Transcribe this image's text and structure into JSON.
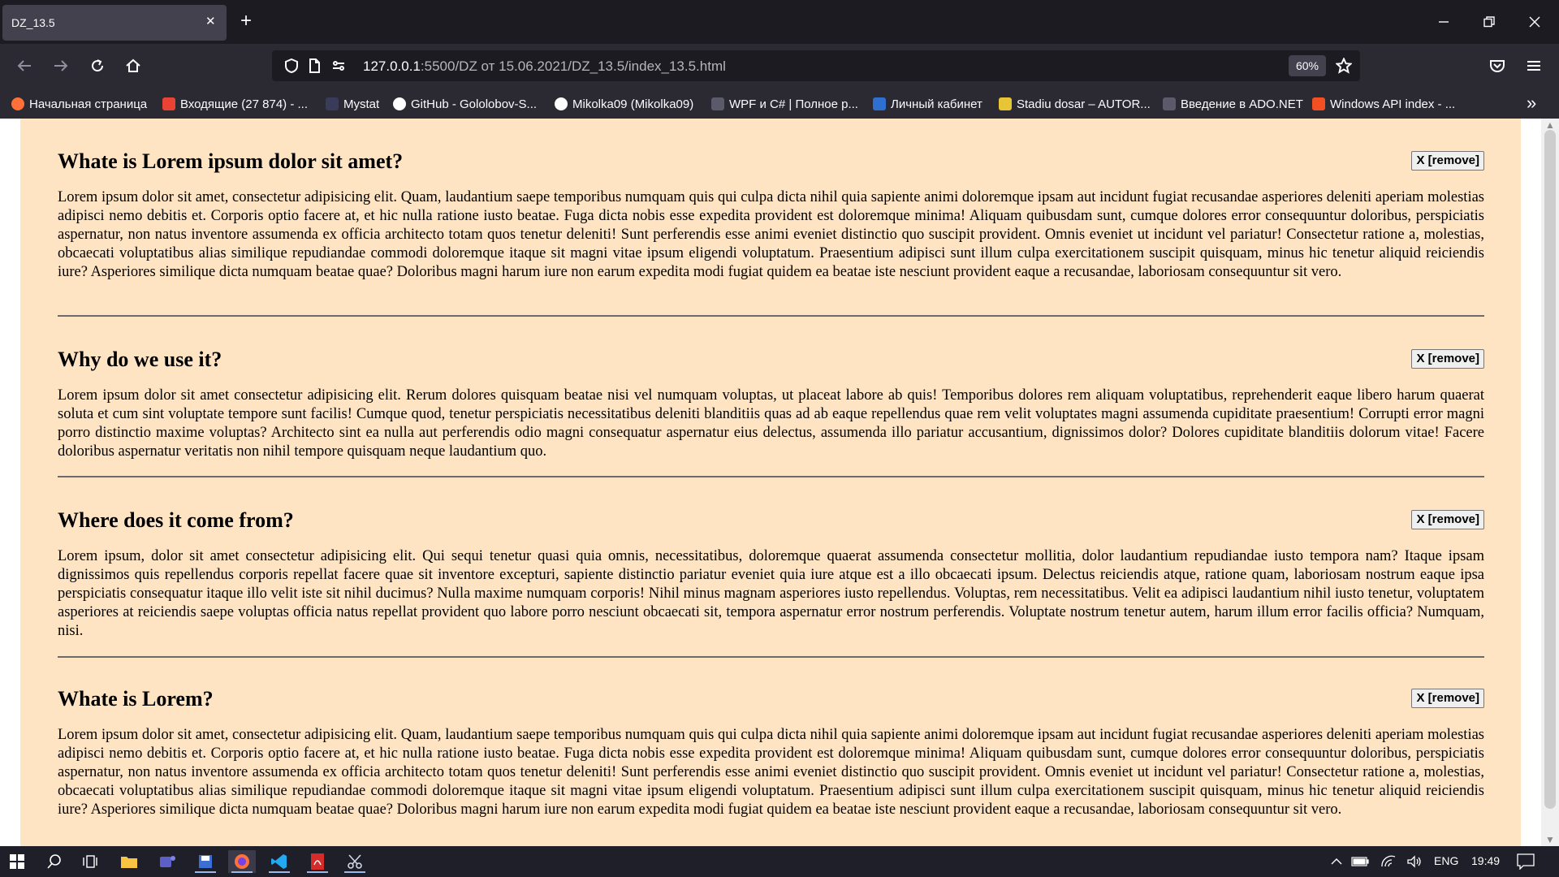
{
  "browser": {
    "tab_title": "DZ_13.5",
    "tab_close": "✕",
    "new_tab": "+",
    "url_host": "127.0.0.1",
    "url_rest": ":5500/DZ от 15.06.2021/DZ_13.5/index_13.5.html",
    "zoom": "60%"
  },
  "bookmarks": [
    {
      "label": "Начальная страница",
      "color": "#ff7139"
    },
    {
      "label": "Входящие (27 874) - ...",
      "color": "#ea4335"
    },
    {
      "label": "Mystat",
      "color": "#3a3a5a"
    },
    {
      "label": "GitHub - Gololobov-S...",
      "color": "#ffffff"
    },
    {
      "label": "Mikolka09 (Mikolka09)",
      "color": "#ffffff"
    },
    {
      "label": "WPF и C# | Полное р...",
      "color": "#5a5a6a"
    },
    {
      "label": "Личный кабинет",
      "color": "#2f6fd1"
    },
    {
      "label": "Stadiu dosar – AUTOR...",
      "color": "#e8c437"
    },
    {
      "label": "Введение в ADO.NET",
      "color": "#5a5a6a"
    },
    {
      "label": "Windows API index - ...",
      "color": "#f25022"
    }
  ],
  "articles": [
    {
      "title": "Whate is Lorem ipsum dolor sit amet?",
      "remove_label": "X [remove]",
      "text": "Lorem ipsum dolor sit amet, consectetur adipisicing elit. Quam, laudantium saepe temporibus numquam quis qui culpa dicta nihil quia sapiente animi doloremque ipsam aut incidunt fugiat recusandae asperiores deleniti aperiam molestias adipisci nemo debitis et. Corporis optio facere at, et hic nulla ratione iusto beatae. Fuga dicta nobis esse expedita provident est doloremque minima! Aliquam quibusdam sunt, cumque dolores error consequuntur doloribus, perspiciatis aspernatur, non natus inventore assumenda ex officia architecto totam quos tenetur deleniti! Sunt perferendis esse animi eveniet distinctio quo suscipit provident. Omnis eveniet ut incidunt vel pariatur! Consectetur ratione a, molestias, obcaecati voluptatibus alias similique repudiandae commodi doloremque itaque sit magni vitae ipsum eligendi voluptatum. Praesentium adipisci sunt illum culpa exercitationem suscipit quisquam, minus hic tenetur aliquid reiciendis iure? Asperiores similique dicta numquam beatae quae? Doloribus magni harum iure non earum expedita modi fugiat quidem ea beatae iste nesciunt provident eaque a recusandae, laboriosam consequuntur sit vero."
    },
    {
      "title": "Why do we use it?",
      "remove_label": "X [remove]",
      "text": "Lorem ipsum dolor sit amet consectetur adipisicing elit. Rerum dolores quisquam beatae nisi vel numquam voluptas, ut placeat labore ab quis! Temporibus dolores rem aliquam voluptatibus, reprehenderit eaque libero harum quaerat soluta et cum sint voluptate tempore sunt facilis! Cumque quod, tenetur perspiciatis necessitatibus deleniti blanditiis quas ad ab eaque repellendus quae rem velit voluptates magni assumenda cupiditate praesentium! Corrupti error magni porro distinctio maxime voluptas? Architecto sint ea nulla aut perferendis odio magni consequatur aspernatur eius delectus, assumenda illo pariatur accusantium, dignissimos dolor? Dolores cupiditate blanditiis dolorum vitae! Facere doloribus aspernatur veritatis non nihil tempore quisquam neque laudantium quo."
    },
    {
      "title": "Where does it come from?",
      "remove_label": "X [remove]",
      "text": "Lorem ipsum, dolor sit amet consectetur adipisicing elit. Qui sequi tenetur quasi quia omnis, necessitatibus, doloremque quaerat assumenda consectetur mollitia, dolor laudantium repudiandae iusto tempora nam? Itaque ipsam dignissimos quis repellendus corporis repellat facere quae sit inventore excepturi, sapiente distinctio pariatur eveniet quia iure atque est a illo obcaecati ipsum. Delectus reiciendis atque, ratione quam, laboriosam nostrum eaque ipsa perspiciatis consequatur itaque illo velit iste sit nihil ducimus? Nulla maxime numquam corporis! Nihil minus magnam asperiores iusto repellendus. Voluptas, rem necessitatibus. Velit ea adipisci laudantium nihil iusto tenetur, voluptatem asperiores at reiciendis saepe voluptas officia natus repellat provident quo labore porro nesciunt obcaecati sit, tempora aspernatur error nostrum perferendis. Voluptate nostrum tenetur autem, harum illum error facilis officia? Numquam, nisi."
    },
    {
      "title": "Whate is Lorem?",
      "remove_label": "X [remove]",
      "text": "Lorem ipsum dolor sit amet, consectetur adipisicing elit. Quam, laudantium saepe temporibus numquam quis qui culpa dicta nihil quia sapiente animi doloremque ipsam aut incidunt fugiat recusandae asperiores deleniti aperiam molestias adipisci nemo debitis et. Corporis optio facere at, et hic nulla ratione iusto beatae. Fuga dicta nobis esse expedita provident est doloremque minima! Aliquam quibusdam sunt, cumque dolores error consequuntur doloribus, perspiciatis aspernatur, non natus inventore assumenda ex officia architecto totam quos tenetur deleniti! Sunt perferendis esse animi eveniet distinctio quo suscipit provident. Omnis eveniet ut incidunt vel pariatur! Consectetur ratione a, molestias, obcaecati voluptatibus alias similique repudiandae commodi doloremque itaque sit magni vitae ipsum eligendi voluptatum. Praesentium adipisci sunt illum culpa exercitationem suscipit quisquam, minus hic tenetur aliquid reiciendis iure? Asperiores similique dicta numquam beatae quae? Doloribus magni harum iure non earum expedita modi fugiat quidem ea beatae iste nesciunt provident eaque a recusandae, laboriosam consequuntur sit vero."
    }
  ],
  "taskbar": {
    "language": "ENG",
    "time": "19:49"
  },
  "colors": {
    "page_background": "#ffe4c4",
    "browser_chrome": "#2b2a33",
    "tab_strip": "#1c1b22"
  }
}
